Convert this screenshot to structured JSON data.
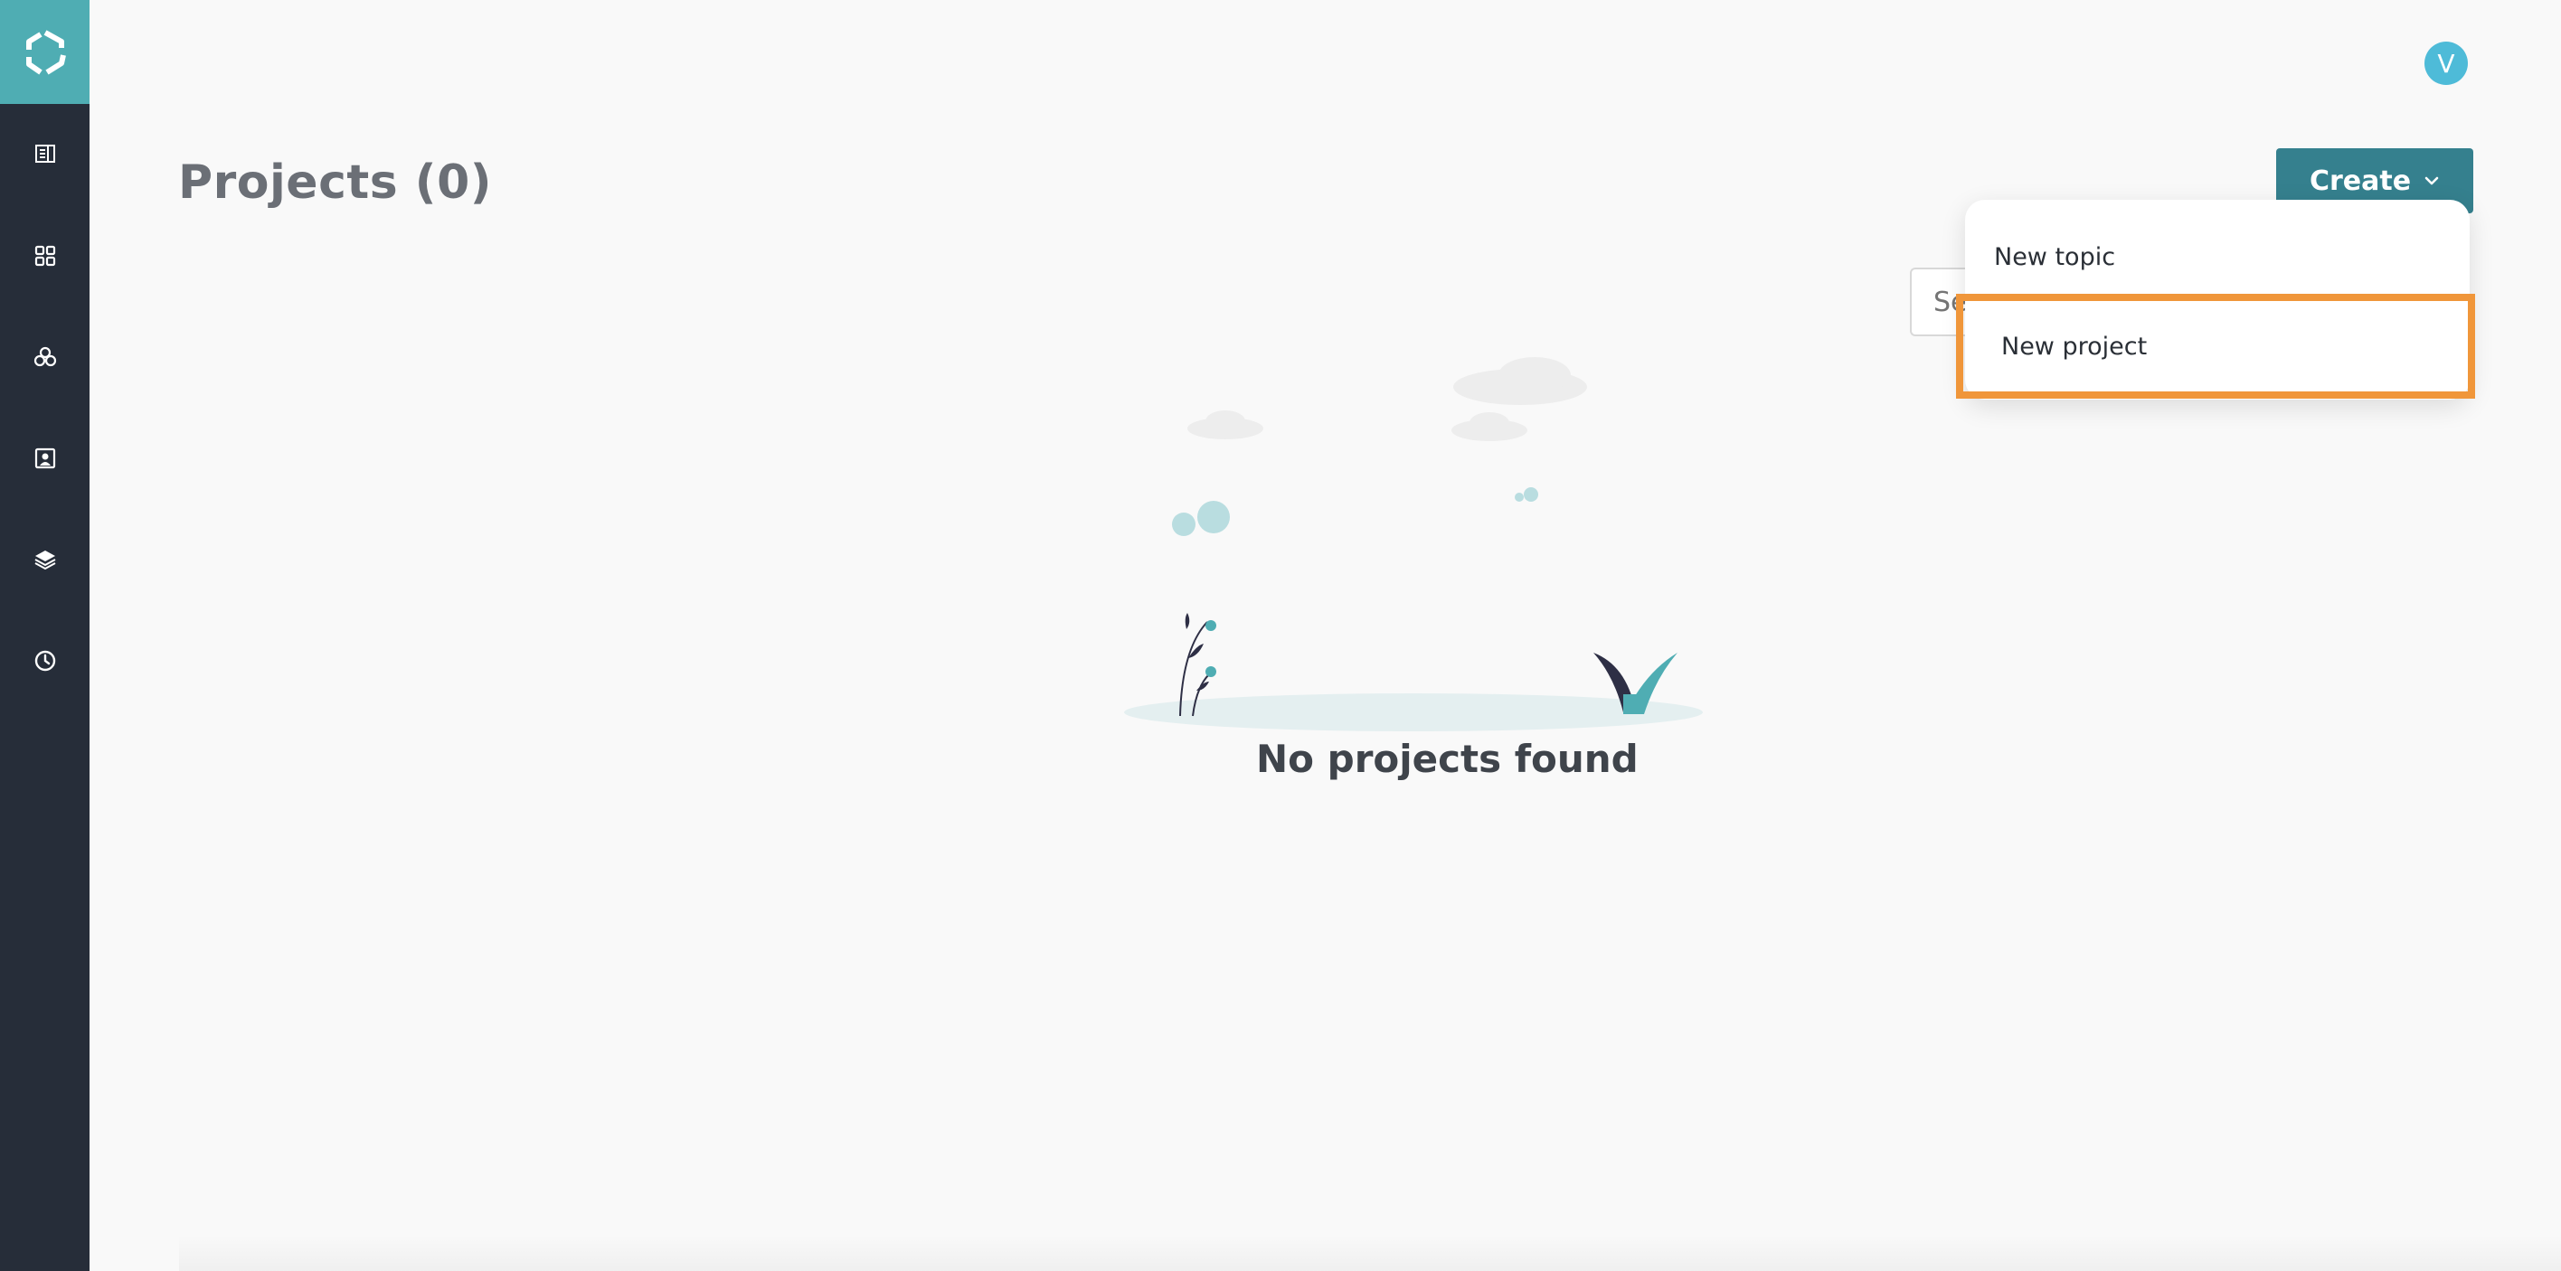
{
  "page": {
    "title": "Projects (0)",
    "empty_message": "No projects found"
  },
  "user": {
    "avatar_initial": "V"
  },
  "toolbar": {
    "create_label": "Create",
    "search_placeholder": "Se"
  },
  "create_menu": {
    "items": [
      {
        "label": "New topic"
      },
      {
        "label": "New project",
        "highlighted": true
      }
    ]
  },
  "sidebar": {
    "items": [
      {
        "icon": "document-list-icon"
      },
      {
        "icon": "grid-icon"
      },
      {
        "icon": "circles-cluster-icon"
      },
      {
        "icon": "contact-card-icon"
      },
      {
        "icon": "layers-icon"
      },
      {
        "icon": "clock-icon"
      }
    ]
  },
  "colors": {
    "sidebar": "#262d39",
    "brand": "#4fadb3",
    "create_button": "#35808e",
    "avatar": "#4ebbd8",
    "highlight": "#f0963a"
  }
}
